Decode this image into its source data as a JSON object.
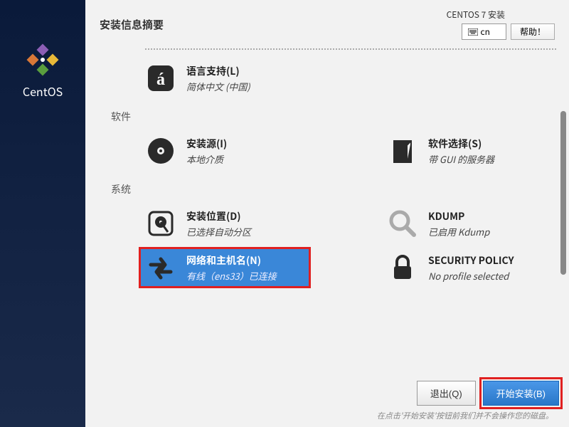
{
  "sidebar": {
    "brand": "CentOS"
  },
  "header": {
    "title": "安装信息摘要",
    "product": "CENTOS 7 安装",
    "keyboard": "cn",
    "help": "帮助！"
  },
  "sections": {
    "localization": {
      "language_support": {
        "title": "语言支持(L)",
        "sub": "简体中文 (中国)"
      }
    },
    "software": {
      "label": "软件",
      "source": {
        "title": "安装源(I)",
        "sub": "本地介质"
      },
      "selection": {
        "title": "软件选择(S)",
        "sub": "带 GUI 的服务器"
      }
    },
    "system": {
      "label": "系统",
      "destination": {
        "title": "安装位置(D)",
        "sub": "已选择自动分区"
      },
      "kdump": {
        "title": "KDUMP",
        "sub": "已启用 Kdump"
      },
      "network": {
        "title": "网络和主机名(N)",
        "sub": "有线（ens33）已连接"
      },
      "security": {
        "title": "SECURITY POLICY",
        "sub": "No profile selected"
      }
    }
  },
  "footer": {
    "quit": "退出(Q)",
    "begin": "开始安装(B)",
    "hint": "在点击'开始安装'按钮前我们并不会操作您的磁盘。"
  }
}
